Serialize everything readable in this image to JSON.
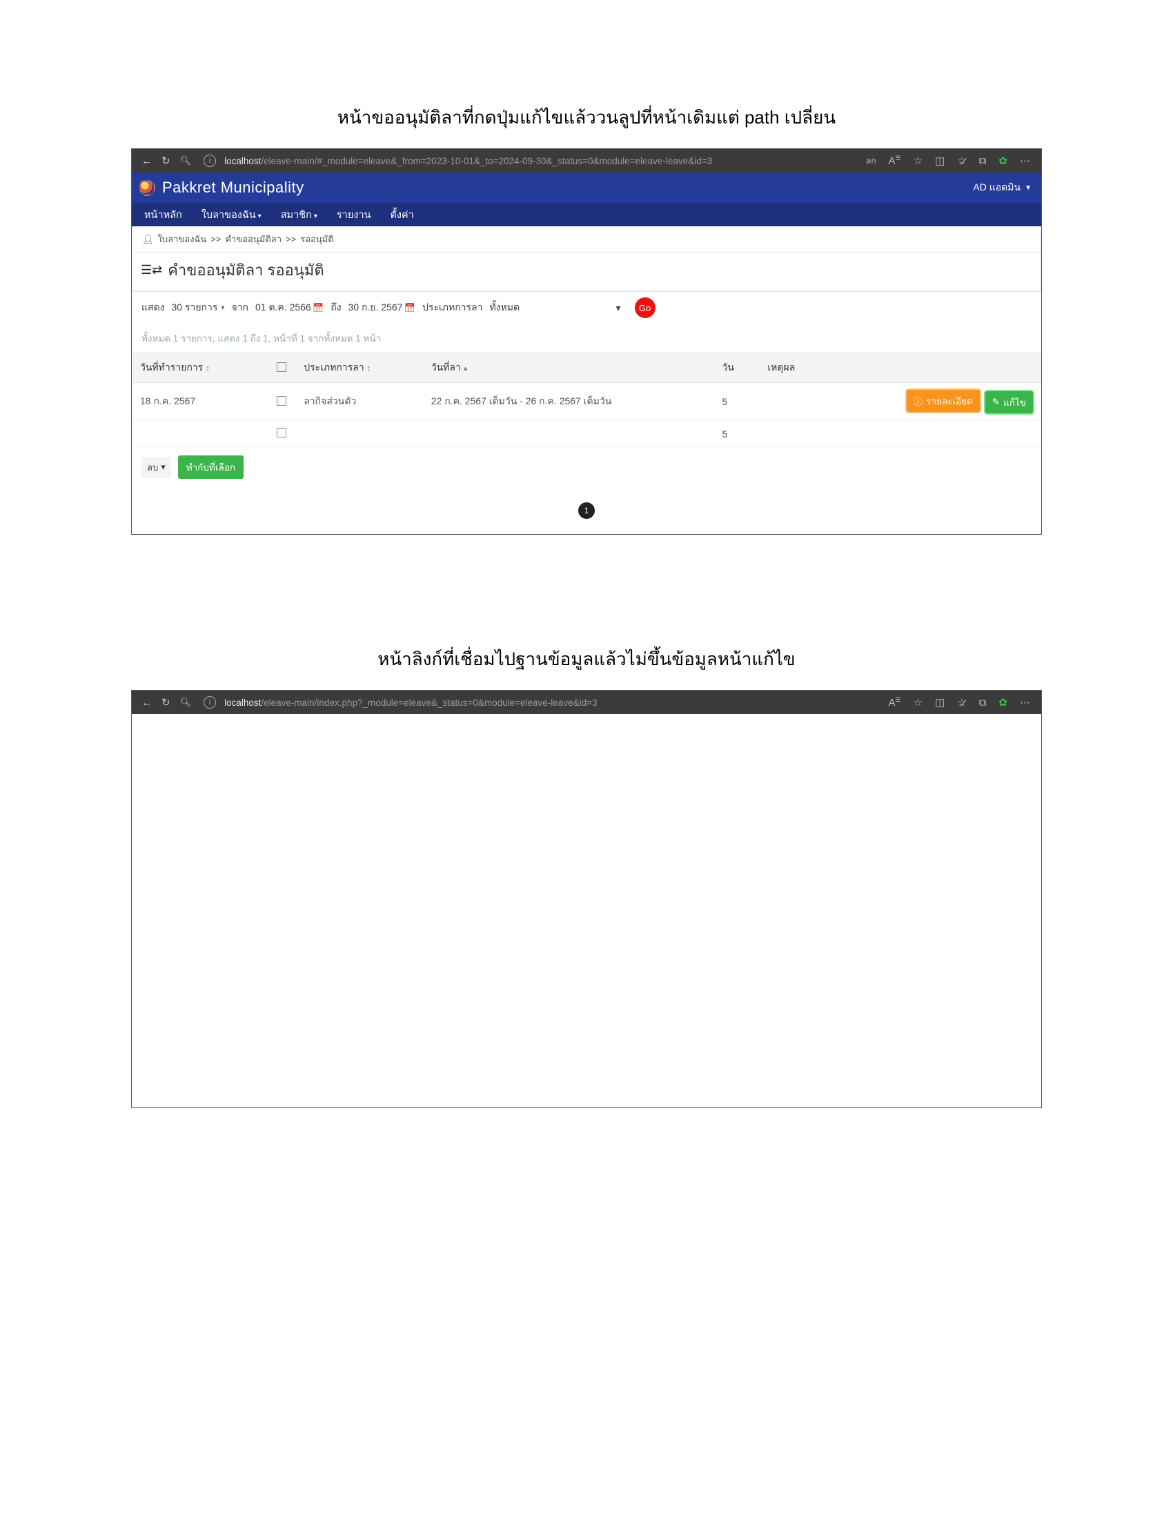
{
  "caption1": "หน้าขออนุมัติลาที่กดปุ่มแก้ไขแล้ววนลูปที่หน้าเดิมแต่ path เปลี่ยน",
  "caption2": "หน้าลิงก์ที่เชื่อมไปฐานข้อมูลแล้วไม่ขึ้นข้อมูลหน้าแก้ไข",
  "browser1": {
    "url_host": "localhost",
    "url_path": "/eleave-main/#_module=eleave&_from=2023-10-01&_to=2024-09-30&_status=0&module=eleave-leave&id=3",
    "lang_badge": "ลก"
  },
  "browser2": {
    "url_host": "localhost",
    "url_path": "/eleave-main/index.php?_module=eleave&_status=0&module=eleave-leave&id=3"
  },
  "app": {
    "title": "Pakkret Municipality",
    "user": "AD แอดมิน",
    "nav": {
      "home": "หน้าหลัก",
      "myleave": "ใบลาของฉัน",
      "member": "สมาชิก",
      "report": "รายงาน",
      "settings": "ตั้งค่า"
    }
  },
  "breadcrumb": {
    "l1": "ใบลาของฉัน",
    "sep": ">>",
    "l2": "คำขออนุมัติลา",
    "l3": "รออนุมัติ"
  },
  "page_title": "คำขออนุมัติลา รออนุมัติ",
  "filters": {
    "show": "แสดง",
    "per_page": "30 รายการ",
    "from": "จาก",
    "date_from": "01 ต.ค. 2566",
    "to": "ถึง",
    "date_to": "30 ก.ย. 2567",
    "leave_type_label": "ประเภทการลา",
    "leave_type_value": "ทั้งหมด",
    "go": "Go"
  },
  "summary": "ทั้งหมด 1 รายการ, แสดง 1 ถึง 1, หน้าที่ 1 จากทั้งหมด 1 หน้า",
  "thead": {
    "c1": "วันที่ทำรายการ",
    "c2": "ประเภทการลา",
    "c3": "วันที่ลา",
    "c4": "วัน",
    "c5": "เหตุผล"
  },
  "row1": {
    "date": "18 ก.ค. 2567",
    "type": "ลากิจส่วนตัว",
    "range": "22 ก.ค. 2567 เต็มวัน - 26 ก.ค. 2567 เต็มวัน",
    "days": "5"
  },
  "row2": {
    "days": "5"
  },
  "actions": {
    "detail": "รายละเอียด",
    "edit": "แก้ไข"
  },
  "bottom": {
    "delete": "ลบ",
    "do_selected": "ทำกับที่เลือก"
  },
  "pager": {
    "current": "1"
  }
}
